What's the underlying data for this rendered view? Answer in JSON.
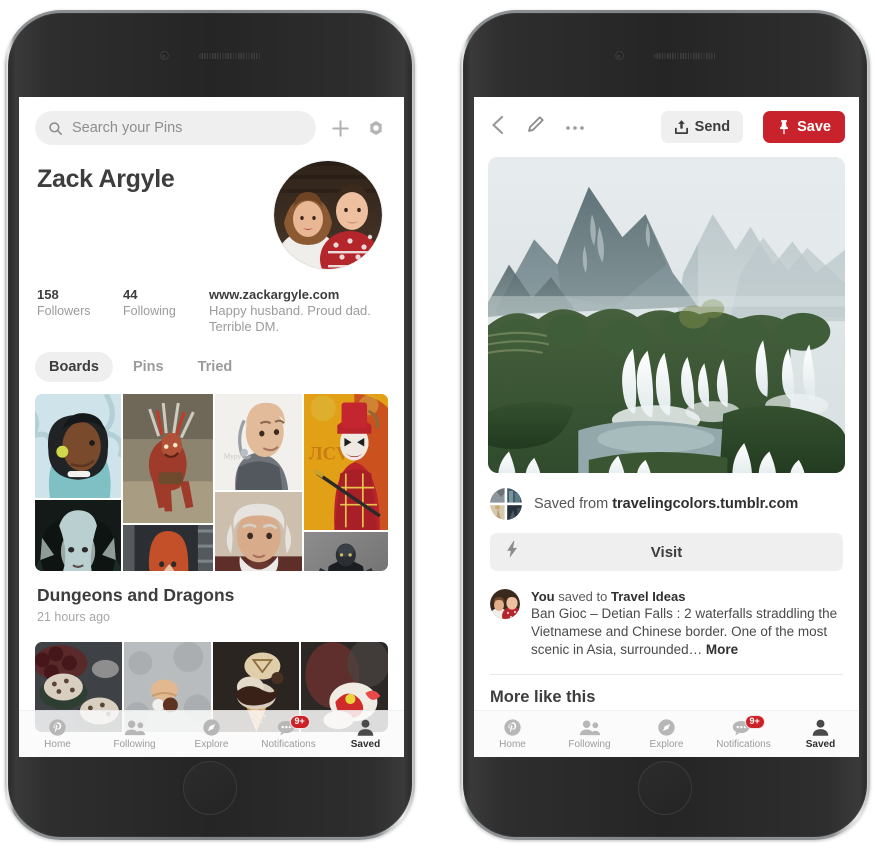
{
  "app": {
    "name": "Pinterest",
    "accent_red": "#c8232c",
    "chrome_gray": "#efefef"
  },
  "left_phone": {
    "search": {
      "placeholder": "Search your Pins",
      "icon": "search-icon"
    },
    "actions": {
      "add": "+",
      "add_icon": "plus-icon",
      "settings_icon": "gear-icon"
    },
    "profile": {
      "name": "Zack Argyle",
      "avatar_alt": "couple-photo-avatar",
      "stats": [
        {
          "value": "158",
          "label": "Followers"
        },
        {
          "value": "44",
          "label": "Following"
        }
      ],
      "website": "www.zackargyle.com",
      "bio": "Happy husband. Proud dad. Terrible DM."
    },
    "tabs": [
      {
        "label": "Boards",
        "active": true
      },
      {
        "label": "Pins",
        "active": false
      },
      {
        "label": "Tried",
        "active": false
      }
    ],
    "boards": [
      {
        "title": "Dungeons and Dragons",
        "time": "21 hours ago",
        "cover_alt": "fantasy-character-art-collage"
      },
      {
        "title": "",
        "time": "",
        "cover_alt": "ice-cream-dessert-collage"
      }
    ],
    "nav": [
      {
        "label": "Home",
        "icon": "pinterest-icon",
        "active": false,
        "badge": ""
      },
      {
        "label": "Following",
        "icon": "people-icon",
        "active": false,
        "badge": ""
      },
      {
        "label": "Explore",
        "icon": "compass-icon",
        "active": false,
        "badge": ""
      },
      {
        "label": "Notifications",
        "icon": "chat-bubbles-icon",
        "active": false,
        "badge": "9+"
      },
      {
        "label": "Saved",
        "icon": "person-icon",
        "active": true,
        "badge": ""
      }
    ]
  },
  "right_phone": {
    "topbar": {
      "back_icon": "chevron-left-icon",
      "edit_icon": "pencil-icon",
      "more_icon": "ellipsis-icon",
      "send_label": "Send",
      "send_icon": "share-upload-icon",
      "save_label": "Save",
      "save_icon": "pin-icon"
    },
    "hero_alt": "ban-gioc-detian-waterfalls-photo",
    "source": {
      "prefix": "Saved from",
      "domain": "travelingcolors.tumblr.com",
      "favicon_alt": "tumblr-collage-favicon"
    },
    "visit": {
      "label": "Visit",
      "icon": "lightning-bolt-icon"
    },
    "description": {
      "actor": "You",
      "action": "saved to",
      "board": "Travel Ideas",
      "text": "Ban Gioc – Detian Falls : 2 waterfalls straddling the Vietnamese and Chinese border. One of the most scenic in Asia, surrounded…",
      "more_label": "More",
      "avatar_alt": "couple-photo-avatar"
    },
    "more_like_this": "More like this",
    "nav": [
      {
        "label": "Home",
        "icon": "pinterest-icon",
        "active": false,
        "badge": ""
      },
      {
        "label": "Following",
        "icon": "people-icon",
        "active": false,
        "badge": ""
      },
      {
        "label": "Explore",
        "icon": "compass-icon",
        "active": false,
        "badge": ""
      },
      {
        "label": "Notifications",
        "icon": "chat-bubbles-icon",
        "active": false,
        "badge": "9+"
      },
      {
        "label": "Saved",
        "icon": "person-icon",
        "active": true,
        "badge": ""
      }
    ]
  }
}
